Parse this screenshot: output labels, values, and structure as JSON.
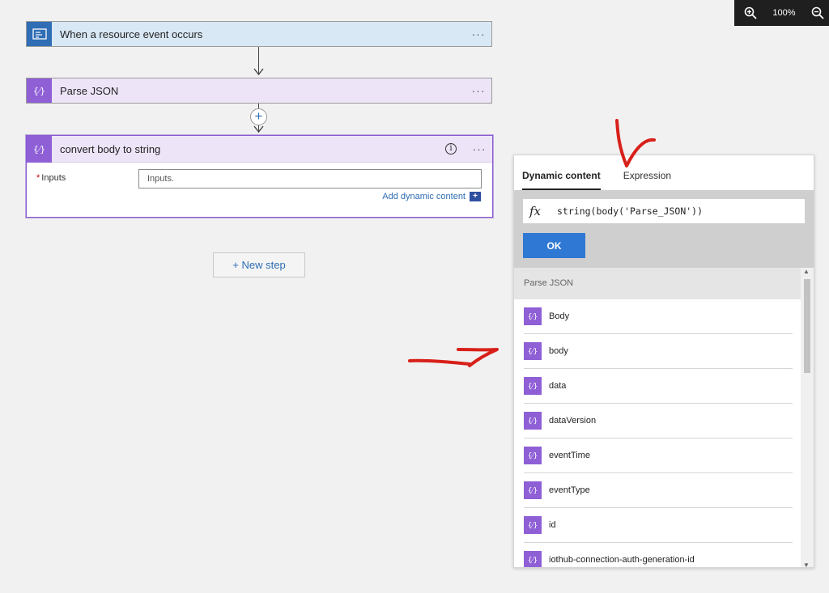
{
  "zoom": {
    "level": "100%"
  },
  "flow": {
    "trigger": {
      "title": "When a resource event occurs",
      "more": "···"
    },
    "parse": {
      "title": "Parse JSON",
      "more": "···"
    },
    "compose": {
      "title": "convert body to string",
      "info": "i",
      "more": "···",
      "required_mark": "*",
      "field_label": "Inputs",
      "field_placeholder": "Inputs.",
      "add_dynamic": "Add dynamic content",
      "add_dynamic_plus": "+"
    },
    "insert_plus": "+",
    "new_step": "+ New step"
  },
  "panel": {
    "tabs": [
      "Dynamic content",
      "Expression"
    ],
    "active_tab": 0,
    "fx": "fx",
    "expression": "string(body('Parse_JSON'))",
    "ok_label": "OK",
    "section_title": "Parse JSON",
    "items": [
      {
        "label": "Body"
      },
      {
        "label": "body"
      },
      {
        "label": "data"
      },
      {
        "label": "dataVersion"
      },
      {
        "label": "eventTime"
      },
      {
        "label": "eventType"
      },
      {
        "label": "id"
      },
      {
        "label": "iothub-connection-auth-generation-id"
      }
    ],
    "item_icon_glyph": "{⁄}"
  },
  "colors": {
    "accent_blue": "#2f78d3",
    "parse_purple": "#8f5fd6",
    "trigger_blue": "#2f6db5",
    "annotation_red": "#d8201a"
  }
}
